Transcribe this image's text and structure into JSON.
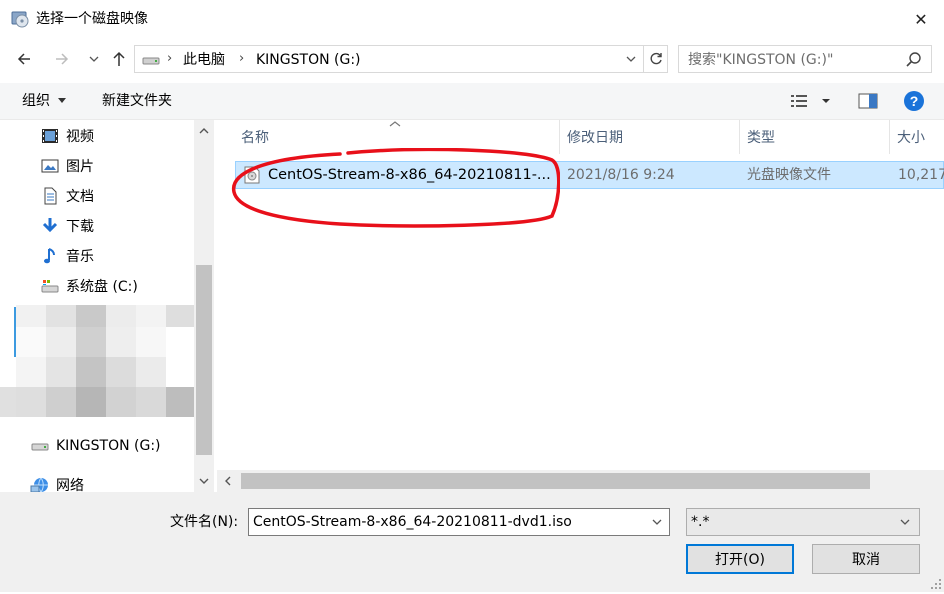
{
  "window": {
    "title": "选择一个磁盘映像",
    "close_glyph": "✕"
  },
  "nav": {
    "breadcrumb": [
      "此电脑",
      "KINGSTON (G:)"
    ],
    "breadcrumb_sep": "›",
    "search_placeholder": "搜索\"KINGSTON (G:)\""
  },
  "toolbar": {
    "organize_label": "组织",
    "new_folder_label": "新建文件夹"
  },
  "sidebar": {
    "items": [
      {
        "label": "视频",
        "icon": "video-icon"
      },
      {
        "label": "图片",
        "icon": "pictures-icon"
      },
      {
        "label": "文档",
        "icon": "documents-icon"
      },
      {
        "label": "下载",
        "icon": "downloads-icon"
      },
      {
        "label": "音乐",
        "icon": "music-icon"
      },
      {
        "label": "系统盘 (C:)",
        "icon": "system-drive-icon"
      },
      {
        "label": "KINGSTON (G:)",
        "icon": "usb-drive-icon"
      },
      {
        "label": "网络",
        "icon": "network-icon"
      }
    ]
  },
  "filelist": {
    "columns": [
      "名称",
      "修改日期",
      "类型",
      "大小"
    ],
    "rows": [
      {
        "name": "CentOS-Stream-8-x86_64-20210811-...",
        "date": "2021/8/16 9:24",
        "type": "光盘映像文件",
        "size": "10,217"
      }
    ]
  },
  "bottom": {
    "filename_label": "文件名(N):",
    "filename_value": "CentOS-Stream-8-x86_64-20210811-dvd1.iso",
    "filter_value": "*.*",
    "open_label": "打开(O)",
    "cancel_label": "取消"
  },
  "colors": {
    "selection_bg": "#cce8ff",
    "selection_border": "#99d1ff",
    "annotation_red": "#e8101a",
    "accent_blue": "#0078d7",
    "help_blue": "#1a73d9"
  }
}
